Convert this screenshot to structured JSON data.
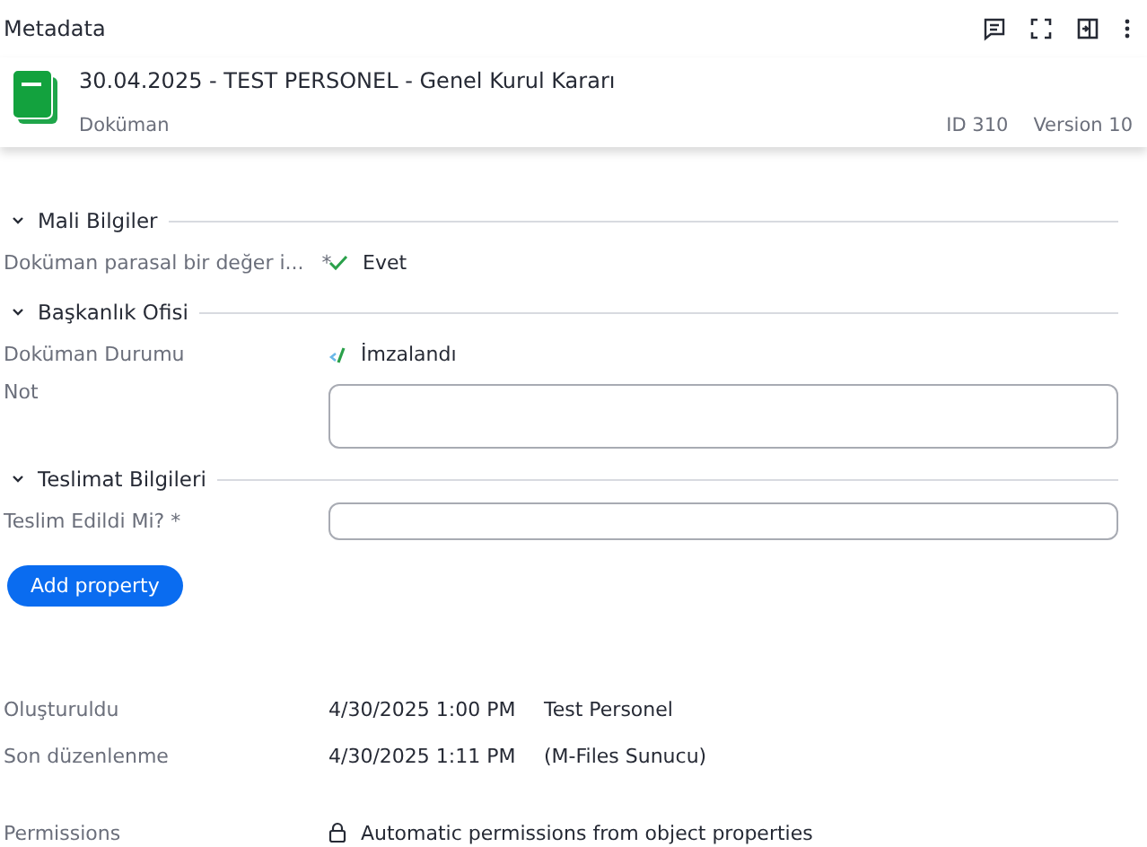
{
  "panel": {
    "title": "Metadata"
  },
  "object": {
    "title": "30.04.2025 - TEST PERSONEL - Genel Kurul Kararı",
    "type": "Doküman",
    "id": "ID 310",
    "version": "Version 10"
  },
  "sections": [
    {
      "title": "Mali Bilgiler",
      "expanded": true,
      "properties": [
        {
          "kind": "boolean",
          "label": "Doküman parasal bir değer i...",
          "mark": "*",
          "value": "Evet"
        }
      ]
    },
    {
      "title": "Başkanlık Ofisi",
      "expanded": true,
      "properties": [
        {
          "kind": "state",
          "label": "Doküman Durumu",
          "value": "İmzalandı"
        },
        {
          "kind": "textarea",
          "label": "Not"
        }
      ]
    },
    {
      "title": "Teslimat Bilgileri",
      "expanded": true,
      "properties": [
        {
          "kind": "text",
          "label": "Teslim Edildi Mi? *"
        }
      ]
    }
  ],
  "add_button": "Add property",
  "info": [
    {
      "label": "Oluşturuldu",
      "date": "4/30/2025 1:00 PM",
      "by": "Test Personel"
    },
    {
      "label": "Son düzenlenme",
      "date": "4/30/2025 1:11 PM",
      "by": "(M-Files Sunucu)"
    }
  ],
  "permissions": {
    "label": "Permissions",
    "value": "Automatic permissions from object properties"
  }
}
